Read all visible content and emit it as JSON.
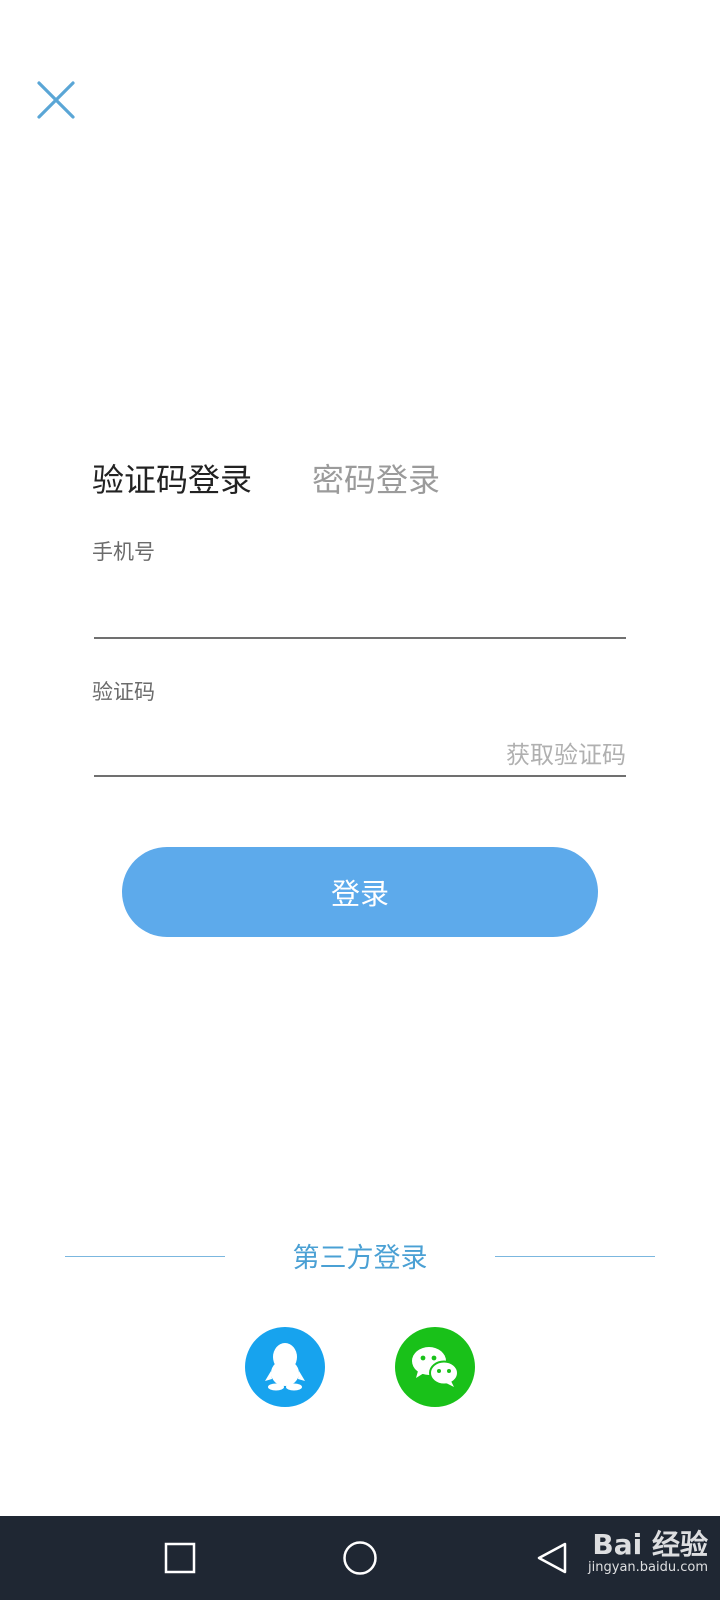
{
  "tabs": [
    {
      "label": "验证码登录",
      "active": true
    },
    {
      "label": "密码登录",
      "active": false
    }
  ],
  "phone": {
    "label": "手机号",
    "value": "",
    "placeholder": ""
  },
  "code": {
    "label": "验证码",
    "value": "",
    "placeholder": "",
    "get_code_label": "获取验证码"
  },
  "login_button": {
    "label": "登录"
  },
  "third_party": {
    "title": "第三方登录",
    "providers": [
      {
        "name": "QQ",
        "icon": "qq-penguin-icon",
        "color": "#17a3ee"
      },
      {
        "name": "WeChat",
        "icon": "wechat-icon",
        "color": "#19c119"
      }
    ]
  },
  "navigation": {
    "recents_icon": "square-icon",
    "home_icon": "circle-icon",
    "back_icon": "triangle-back-icon"
  },
  "watermark": {
    "brand": "Bai 经验",
    "url": "jingyan.baidu.com"
  },
  "colors": {
    "accent": "#5daaeb",
    "close_icon": "#5aa6d6",
    "third_party_text": "#4aa0d4",
    "navbar": "#1f2733"
  }
}
